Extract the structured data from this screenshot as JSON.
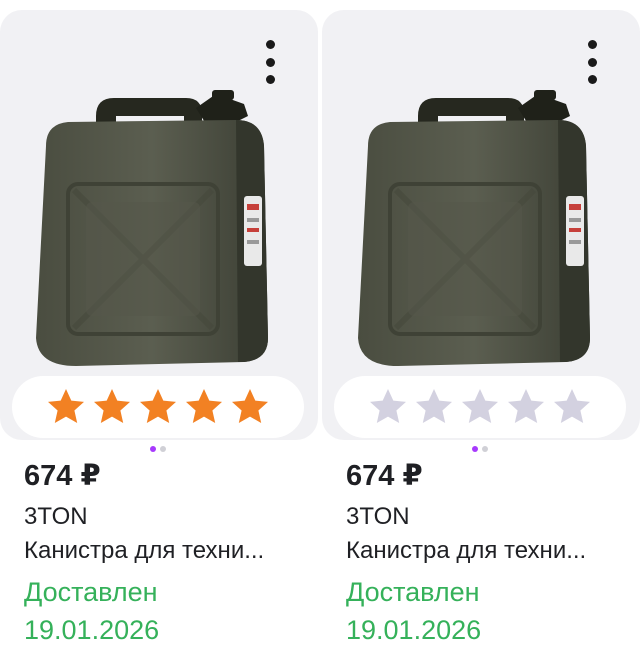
{
  "colors": {
    "star_filled": "#f28123",
    "star_empty": "#d3d1e0",
    "delivered_green": "#35b15a",
    "pager_active": "#a73afd",
    "card_bg": "#f1f1f4"
  },
  "cards": [
    {
      "price": "674 ₽",
      "brand": "3TON",
      "title": "Канистра для техни...",
      "status": "Доставлен",
      "date": "19.01.2026",
      "rating": 5,
      "image_icon": "jerrycan-image"
    },
    {
      "price": "674 ₽",
      "brand": "3TON",
      "title": "Канистра для техни...",
      "status": "Доставлен",
      "date": "19.01.2026",
      "rating": 0,
      "image_icon": "jerrycan-image"
    }
  ]
}
